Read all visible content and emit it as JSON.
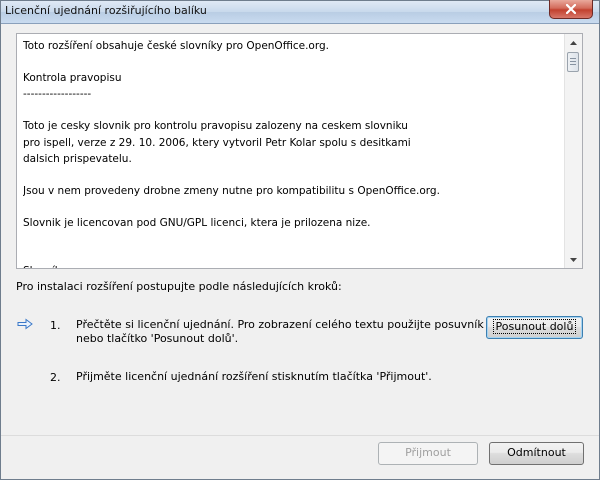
{
  "window": {
    "title": "Licenční ujednání rozšiřujícího balíku"
  },
  "license_text": [
    "Toto rozšíření obsahuje české slovníky pro OpenOffice.org.",
    "",
    "Kontrola pravopisu",
    "------------------",
    "",
    "Toto je cesky slovnik pro kontrolu pravopisu zalozeny na ceskem slovniku",
    "pro ispell, verze z 29. 10. 2006, ktery vytvoril Petr Kolar spolu s desitkami",
    "dalsich prispevatelu.",
    "",
    "Jsou v nem provedeny drobne zmeny nutne pro kompatibilitu s OpenOffice.org.",
    "",
    "Slovnik je licencovan pod GNU/GPL licenci, ktera je prilozena nize.",
    "",
    "",
    "Slovník synonym",
    "---------------"
  ],
  "instructions": {
    "heading": "Pro instalaci rozšíření postupujte podle následujících kroků:",
    "steps": [
      {
        "num": "1.",
        "text": "Přečtěte si licenční ujednání. Pro zobrazení celého textu použijte posuvník\nnebo tlačítko 'Posunout dolů'."
      },
      {
        "num": "2.",
        "text": "Přijměte licenční ujednání rozšíření stisknutím tlačítka 'Přijmout'."
      }
    ]
  },
  "buttons": {
    "scroll_down": "Posunout dolů",
    "accept": "Přijmout",
    "decline": "Odmítnout"
  },
  "icons": {
    "close": "close-icon",
    "current_step": "arrow-right-icon"
  },
  "colors": {
    "arrow": "#3a78c8",
    "close_button": "#c2412f"
  }
}
